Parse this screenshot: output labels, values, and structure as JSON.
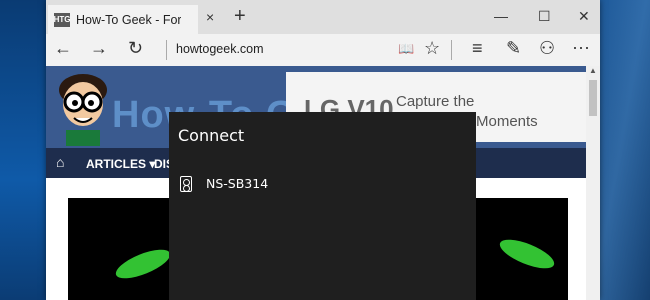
{
  "browser": {
    "tab": {
      "favicon": "HTG",
      "title": "How-To Geek - For Geeks"
    },
    "new_tab_icon": "+",
    "close_tab_icon": "×",
    "window_controls": {
      "minimize": "—",
      "maximize": "☐",
      "close": "✕"
    },
    "address": "howtogeek.com",
    "icons": {
      "back": "←",
      "forward": "→",
      "refresh": "↻",
      "reading_view": "📖",
      "favorite": "☆",
      "hub": "≡",
      "web_note": "✎",
      "share": "⚇",
      "more": "···"
    }
  },
  "website": {
    "logo": "How-To Geek",
    "ad": {
      "brand": "LG V10",
      "text_line1": "Capture the",
      "text_line2": "Moments"
    },
    "nav": {
      "home_icon": "⌂",
      "articles": "ARTICLES ▾",
      "dis": "DIS"
    }
  },
  "connect_panel": {
    "title": "Connect",
    "devices": [
      {
        "name": "NS-SB314",
        "icon": "speaker-icon"
      }
    ]
  },
  "colors": {
    "panel_bg": "#1f1f1f",
    "site_nav": "#1e2d4d",
    "accent_green": "#33c233"
  }
}
